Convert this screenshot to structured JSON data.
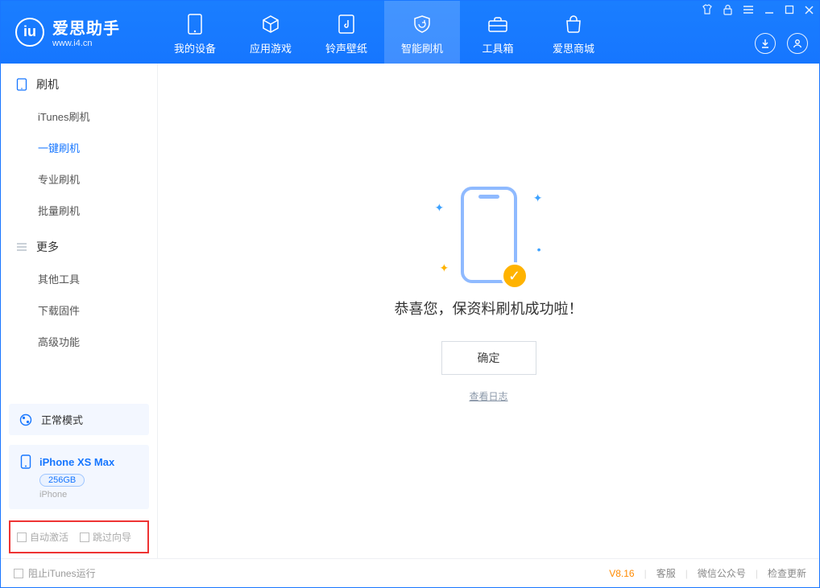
{
  "logo": {
    "title": "爱思助手",
    "subtitle": "www.i4.cn"
  },
  "nav": {
    "my_device": "我的设备",
    "apps_games": "应用游戏",
    "ring_wall": "铃声壁纸",
    "smart_flash": "智能刷机",
    "toolbox": "工具箱",
    "store": "爱思商城"
  },
  "sidebar": {
    "group_flash": "刷机",
    "items_flash": {
      "itunes": "iTunes刷机",
      "onekey": "一键刷机",
      "pro": "专业刷机",
      "batch": "批量刷机"
    },
    "group_more": "更多",
    "items_more": {
      "other_tools": "其他工具",
      "download_fw": "下载固件",
      "advanced": "高级功能"
    },
    "mode_card": "正常模式",
    "device": {
      "name": "iPhone XS Max",
      "storage": "256GB",
      "type": "iPhone"
    },
    "checkbox_auto_activate": "自动激活",
    "checkbox_skip_wizard": "跳过向导"
  },
  "main": {
    "message": "恭喜您，保资料刷机成功啦！",
    "ok": "确定",
    "view_log": "查看日志"
  },
  "footer": {
    "block_itunes": "阻止iTunes运行",
    "version": "V8.16",
    "support": "客服",
    "wechat": "微信公众号",
    "check_update": "检查更新"
  }
}
